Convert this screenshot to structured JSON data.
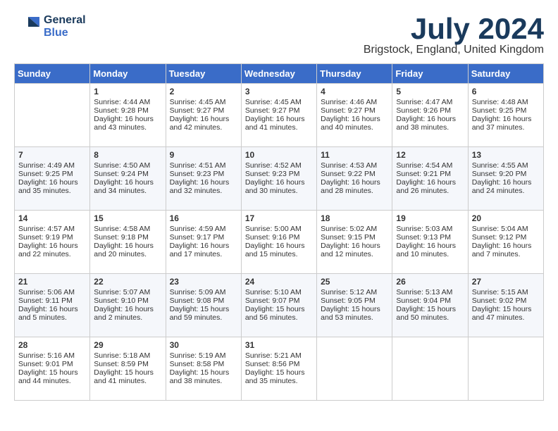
{
  "logo": {
    "line1": "General",
    "line2": "Blue"
  },
  "title": "July 2024",
  "location": "Brigstock, England, United Kingdom",
  "weekdays": [
    "Sunday",
    "Monday",
    "Tuesday",
    "Wednesday",
    "Thursday",
    "Friday",
    "Saturday"
  ],
  "weeks": [
    [
      {
        "day": "",
        "empty": true
      },
      {
        "day": "1",
        "sunrise": "Sunrise: 4:44 AM",
        "sunset": "Sunset: 9:28 PM",
        "daylight": "Daylight: 16 hours and 43 minutes."
      },
      {
        "day": "2",
        "sunrise": "Sunrise: 4:45 AM",
        "sunset": "Sunset: 9:27 PM",
        "daylight": "Daylight: 16 hours and 42 minutes."
      },
      {
        "day": "3",
        "sunrise": "Sunrise: 4:45 AM",
        "sunset": "Sunset: 9:27 PM",
        "daylight": "Daylight: 16 hours and 41 minutes."
      },
      {
        "day": "4",
        "sunrise": "Sunrise: 4:46 AM",
        "sunset": "Sunset: 9:27 PM",
        "daylight": "Daylight: 16 hours and 40 minutes."
      },
      {
        "day": "5",
        "sunrise": "Sunrise: 4:47 AM",
        "sunset": "Sunset: 9:26 PM",
        "daylight": "Daylight: 16 hours and 38 minutes."
      },
      {
        "day": "6",
        "sunrise": "Sunrise: 4:48 AM",
        "sunset": "Sunset: 9:25 PM",
        "daylight": "Daylight: 16 hours and 37 minutes."
      }
    ],
    [
      {
        "day": "7",
        "sunrise": "Sunrise: 4:49 AM",
        "sunset": "Sunset: 9:25 PM",
        "daylight": "Daylight: 16 hours and 35 minutes."
      },
      {
        "day": "8",
        "sunrise": "Sunrise: 4:50 AM",
        "sunset": "Sunset: 9:24 PM",
        "daylight": "Daylight: 16 hours and 34 minutes."
      },
      {
        "day": "9",
        "sunrise": "Sunrise: 4:51 AM",
        "sunset": "Sunset: 9:23 PM",
        "daylight": "Daylight: 16 hours and 32 minutes."
      },
      {
        "day": "10",
        "sunrise": "Sunrise: 4:52 AM",
        "sunset": "Sunset: 9:23 PM",
        "daylight": "Daylight: 16 hours and 30 minutes."
      },
      {
        "day": "11",
        "sunrise": "Sunrise: 4:53 AM",
        "sunset": "Sunset: 9:22 PM",
        "daylight": "Daylight: 16 hours and 28 minutes."
      },
      {
        "day": "12",
        "sunrise": "Sunrise: 4:54 AM",
        "sunset": "Sunset: 9:21 PM",
        "daylight": "Daylight: 16 hours and 26 minutes."
      },
      {
        "day": "13",
        "sunrise": "Sunrise: 4:55 AM",
        "sunset": "Sunset: 9:20 PM",
        "daylight": "Daylight: 16 hours and 24 minutes."
      }
    ],
    [
      {
        "day": "14",
        "sunrise": "Sunrise: 4:57 AM",
        "sunset": "Sunset: 9:19 PM",
        "daylight": "Daylight: 16 hours and 22 minutes."
      },
      {
        "day": "15",
        "sunrise": "Sunrise: 4:58 AM",
        "sunset": "Sunset: 9:18 PM",
        "daylight": "Daylight: 16 hours and 20 minutes."
      },
      {
        "day": "16",
        "sunrise": "Sunrise: 4:59 AM",
        "sunset": "Sunset: 9:17 PM",
        "daylight": "Daylight: 16 hours and 17 minutes."
      },
      {
        "day": "17",
        "sunrise": "Sunrise: 5:00 AM",
        "sunset": "Sunset: 9:16 PM",
        "daylight": "Daylight: 16 hours and 15 minutes."
      },
      {
        "day": "18",
        "sunrise": "Sunrise: 5:02 AM",
        "sunset": "Sunset: 9:15 PM",
        "daylight": "Daylight: 16 hours and 12 minutes."
      },
      {
        "day": "19",
        "sunrise": "Sunrise: 5:03 AM",
        "sunset": "Sunset: 9:13 PM",
        "daylight": "Daylight: 16 hours and 10 minutes."
      },
      {
        "day": "20",
        "sunrise": "Sunrise: 5:04 AM",
        "sunset": "Sunset: 9:12 PM",
        "daylight": "Daylight: 16 hours and 7 minutes."
      }
    ],
    [
      {
        "day": "21",
        "sunrise": "Sunrise: 5:06 AM",
        "sunset": "Sunset: 9:11 PM",
        "daylight": "Daylight: 16 hours and 5 minutes."
      },
      {
        "day": "22",
        "sunrise": "Sunrise: 5:07 AM",
        "sunset": "Sunset: 9:10 PM",
        "daylight": "Daylight: 16 hours and 2 minutes."
      },
      {
        "day": "23",
        "sunrise": "Sunrise: 5:09 AM",
        "sunset": "Sunset: 9:08 PM",
        "daylight": "Daylight: 15 hours and 59 minutes."
      },
      {
        "day": "24",
        "sunrise": "Sunrise: 5:10 AM",
        "sunset": "Sunset: 9:07 PM",
        "daylight": "Daylight: 15 hours and 56 minutes."
      },
      {
        "day": "25",
        "sunrise": "Sunrise: 5:12 AM",
        "sunset": "Sunset: 9:05 PM",
        "daylight": "Daylight: 15 hours and 53 minutes."
      },
      {
        "day": "26",
        "sunrise": "Sunrise: 5:13 AM",
        "sunset": "Sunset: 9:04 PM",
        "daylight": "Daylight: 15 hours and 50 minutes."
      },
      {
        "day": "27",
        "sunrise": "Sunrise: 5:15 AM",
        "sunset": "Sunset: 9:02 PM",
        "daylight": "Daylight: 15 hours and 47 minutes."
      }
    ],
    [
      {
        "day": "28",
        "sunrise": "Sunrise: 5:16 AM",
        "sunset": "Sunset: 9:01 PM",
        "daylight": "Daylight: 15 hours and 44 minutes."
      },
      {
        "day": "29",
        "sunrise": "Sunrise: 5:18 AM",
        "sunset": "Sunset: 8:59 PM",
        "daylight": "Daylight: 15 hours and 41 minutes."
      },
      {
        "day": "30",
        "sunrise": "Sunrise: 5:19 AM",
        "sunset": "Sunset: 8:58 PM",
        "daylight": "Daylight: 15 hours and 38 minutes."
      },
      {
        "day": "31",
        "sunrise": "Sunrise: 5:21 AM",
        "sunset": "Sunset: 8:56 PM",
        "daylight": "Daylight: 15 hours and 35 minutes."
      },
      {
        "day": "",
        "empty": true
      },
      {
        "day": "",
        "empty": true
      },
      {
        "day": "",
        "empty": true
      }
    ]
  ]
}
